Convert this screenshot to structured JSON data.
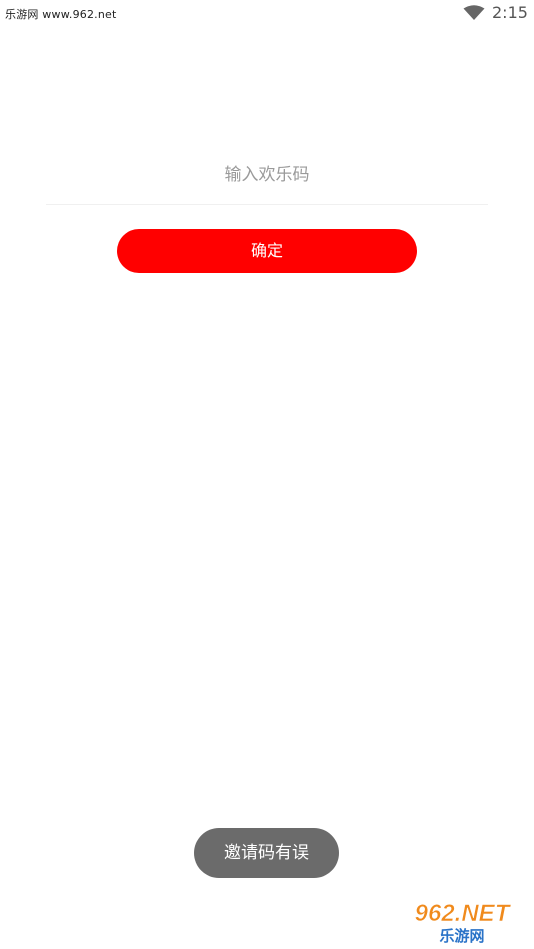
{
  "status_bar": {
    "site_text": "乐游网 www.962.net",
    "time": "2:15"
  },
  "form": {
    "code_placeholder": "输入欢乐码",
    "code_value": "",
    "confirm_label": "确定"
  },
  "toast": {
    "message": "邀请码有误"
  },
  "watermark": {
    "text_top": "962.NET",
    "text_bottom": "乐游网"
  },
  "colors": {
    "accent": "#ff0000",
    "toast_bg": "#6b6b6b",
    "background": "#ffffff"
  }
}
